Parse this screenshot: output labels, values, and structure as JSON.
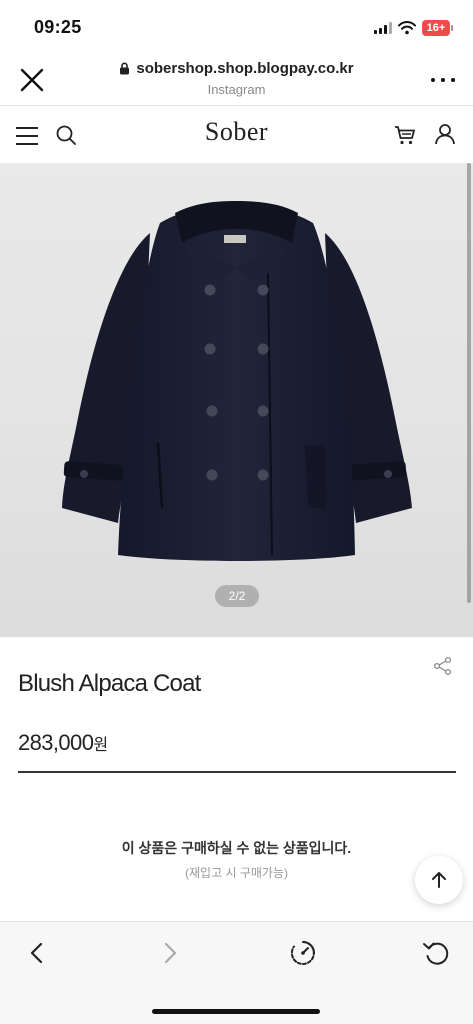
{
  "status_bar": {
    "time": "09:25",
    "battery": "16+"
  },
  "browser": {
    "url": "sobershop.shop.blogpay.co.kr",
    "source": "Instagram"
  },
  "site": {
    "logo": "Sober"
  },
  "product": {
    "image_pager": "2/2",
    "name": "Blush Alpaca Coat",
    "price": "283,000",
    "currency": "원",
    "soldout_message": "이 상품은 구매하실 수 없는 상품입니다.",
    "restock_note": "(재입고 시 구매가능)"
  },
  "icons": {
    "close": "close-icon",
    "lock": "lock-icon",
    "more": "more-icon",
    "menu": "menu-icon",
    "search": "search-icon",
    "cart": "cart-icon",
    "user": "user-icon",
    "share": "share-icon",
    "scroll_top": "arrow-up-icon",
    "back": "chevron-left-icon",
    "forward": "chevron-right-icon",
    "speed": "speedometer-icon",
    "reload": "reload-icon"
  },
  "colors": {
    "battery": "#ee4c4c",
    "coat": "#1c1e2c",
    "background": "#e6e6e6"
  }
}
